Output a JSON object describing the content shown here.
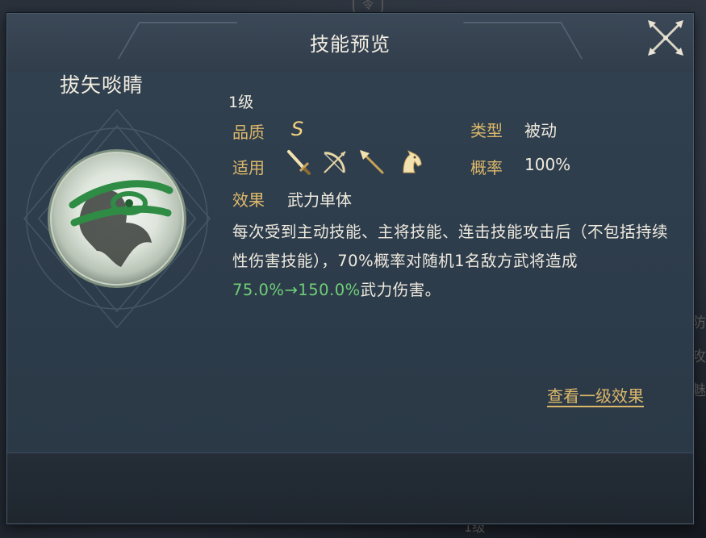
{
  "dialog": {
    "title": "技能预览",
    "close_icon": "crossed-swords-close-icon"
  },
  "skill": {
    "name": "拔矢啖睛",
    "level": "1级",
    "quality_label": "品质",
    "quality_value": "S",
    "type_label": "类型",
    "type_value": "被动",
    "applicable_label": "适用",
    "applicable_icons": [
      "sword-icon",
      "bow-icon",
      "spear-icon",
      "horse-icon"
    ],
    "probability_label": "概率",
    "probability_value": "100%",
    "effect_label": "效果",
    "effect_value": "武力单体",
    "description_part1": "每次受到主动技能、主将技能、连击技能攻击后（不包括持续性伤害技能），70%概率对随机1名敌方武将造成",
    "description_highlight": "75.0%→150.0%",
    "description_part2": "武力伤害。",
    "view_level_one_link": "查看一级效果"
  },
  "background": {
    "right_edge_chars": [
      "防",
      "攻",
      "魅"
    ],
    "bottom_text": "1级",
    "top_badge": "令"
  },
  "colors": {
    "label_gold": "#ddb86a",
    "highlight_green": "#6fcf78",
    "panel_bg": "#2b3947"
  }
}
